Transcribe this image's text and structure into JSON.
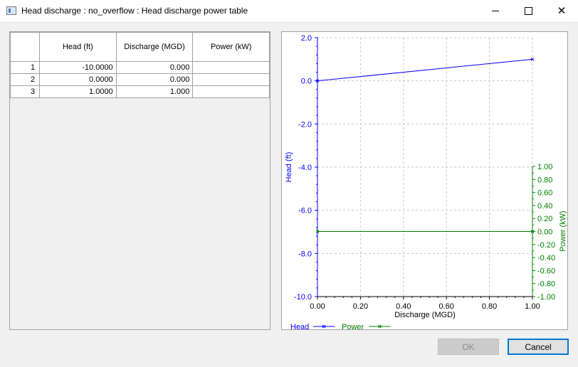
{
  "window": {
    "title": "Head discharge : no_overflow : Head discharge power table",
    "minimize_glyph": "—",
    "maximize_glyph": "☐",
    "close_glyph": "✕"
  },
  "table": {
    "columns": [
      "",
      "Head (ft)",
      "Discharge (MGD)",
      "Power (kW)"
    ],
    "rows": [
      {
        "index": "1",
        "head": "-10.0000",
        "discharge": "0.000",
        "power": ""
      },
      {
        "index": "2",
        "head": "0.0000",
        "discharge": "0.000",
        "power": ""
      },
      {
        "index": "3",
        "head": "1.0000",
        "discharge": "1.000",
        "power": ""
      }
    ]
  },
  "chart_data": {
    "type": "line",
    "xlabel": "Discharge (MGD)",
    "ylabel_left": "Head (ft)",
    "ylabel_right": "Power (kW)",
    "xlim": [
      0,
      1
    ],
    "ylim_left": [
      -10,
      2
    ],
    "ylim_right": [
      -1,
      1
    ],
    "x_ticks": [
      "0.00",
      "0.20",
      "0.40",
      "0.60",
      "0.80",
      "1.00"
    ],
    "y_left_ticks": [
      "2.0",
      "0.0",
      "-2.0",
      "-4.0",
      "-6.0",
      "-8.0",
      "-10.0"
    ],
    "y_right_ticks": [
      "1.00",
      "0.80",
      "0.60",
      "0.40",
      "0.20",
      "0.00",
      "-0.20",
      "-0.40",
      "-0.60",
      "-0.80",
      "-1.00"
    ],
    "grid": true,
    "legend_placement": "bottom-left",
    "series": [
      {
        "name": "Head",
        "axis": "left",
        "color": "#0000ff",
        "x": [
          0,
          1
        ],
        "y": [
          0,
          1
        ]
      },
      {
        "name": "Power",
        "axis": "right",
        "color": "#008000",
        "x": [
          0,
          1
        ],
        "y": [
          0,
          0
        ]
      }
    ]
  },
  "buttons": {
    "ok": "OK",
    "cancel": "Cancel"
  },
  "colors": {
    "accent": "#0078d7",
    "head_series": "#0000ff",
    "power_series": "#008000"
  }
}
